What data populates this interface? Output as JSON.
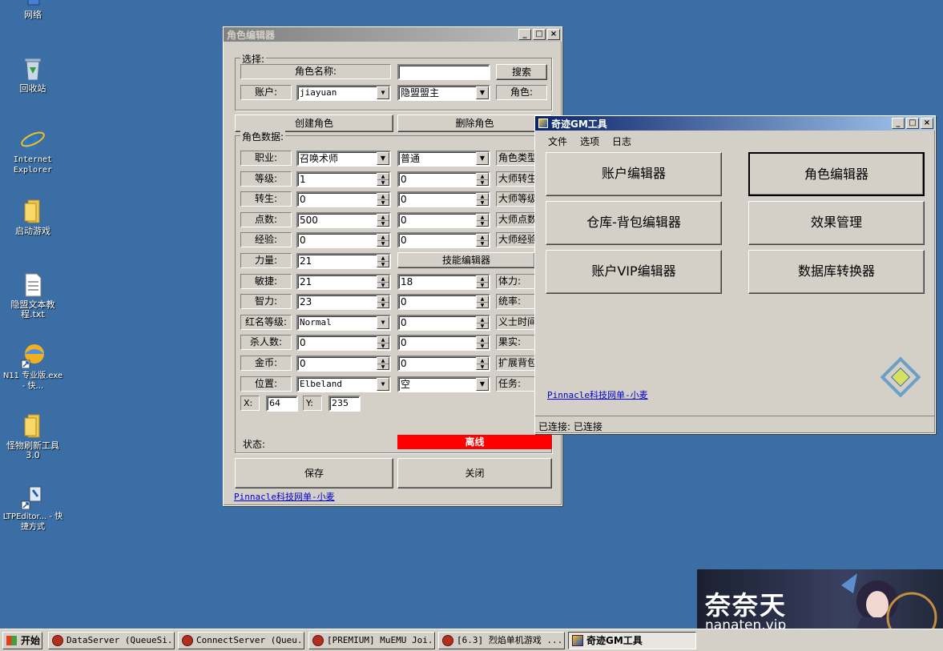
{
  "desktop": {
    "icons": [
      {
        "label": "网络",
        "icon": "network-icon"
      },
      {
        "label": "回收站",
        "icon": "recycle-bin-icon"
      },
      {
        "label": "Internet Explorer",
        "icon": "internet-explorer-icon"
      },
      {
        "label": "启动游戏",
        "icon": "folder-icon"
      },
      {
        "label": "隐盟文本教程.txt",
        "icon": "text-file-icon"
      },
      {
        "label": "N11 专业版.exe - 快...",
        "icon": "shortcut-icon"
      },
      {
        "label": "怪物刷新工具3.0",
        "icon": "folder-icon"
      },
      {
        "label": "LTPEditor... - 快捷方式",
        "icon": "shortcut-icon"
      }
    ]
  },
  "char_editor": {
    "title": "角色编辑器",
    "select_group": "选择:",
    "char_name_label": "角色名称:",
    "char_name_value": "",
    "search_btn": "搜索",
    "account_label": "账户:",
    "account_value": "jiayuan",
    "guild_value": "隐盟盟主",
    "role_label": "角色:",
    "create_btn": "创建角色",
    "delete_btn": "删除角色",
    "data_group": "角色数据:",
    "rows": [
      {
        "label": "职业:",
        "v1": "召唤术师",
        "v2": "普通",
        "r": "角色类型"
      },
      {
        "label": "等级:",
        "v1": "1",
        "v2": "0",
        "r": "大师转生"
      },
      {
        "label": "转生:",
        "v1": "0",
        "v2": "0",
        "r": "大师等级"
      },
      {
        "label": "点数:",
        "v1": "500",
        "v2": "0",
        "r": "大师点数"
      },
      {
        "label": "经验:",
        "v1": "0",
        "v2": "0",
        "r": "大师经验"
      },
      {
        "label": "力量:",
        "v1": "21",
        "v2": "技能编辑器",
        "r": ""
      },
      {
        "label": "敏捷:",
        "v1": "21",
        "v2": "18",
        "r": "体力:"
      },
      {
        "label": "智力:",
        "v1": "23",
        "v2": "0",
        "r": "统率:"
      },
      {
        "label": "红名等级:",
        "v1": "Normal",
        "v2": "0",
        "r": "义士时间"
      },
      {
        "label": "杀人数:",
        "v1": "0",
        "v2": "0",
        "r": "果实:"
      },
      {
        "label": "金币:",
        "v1": "0",
        "v2": "0",
        "r": "扩展背包"
      },
      {
        "label": "位置:",
        "v1": "Elbeland",
        "v2": "空",
        "r": "任务:"
      }
    ],
    "x_label": "X:",
    "x_value": "64",
    "y_label": "Y:",
    "y_value": "235",
    "status_label": "状态:",
    "status_value": "离线",
    "save_btn": "保存",
    "close_btn": "关闭",
    "footer_link": "Pinnacle科技网单-小麦"
  },
  "gm_tool": {
    "title": "奇迹GM工具",
    "menu": [
      "文件",
      "选项",
      "日志"
    ],
    "buttons": [
      "账户编辑器",
      "角色编辑器",
      "仓库-背包编辑器",
      "效果管理",
      "账户VIP编辑器",
      "数据库转换器"
    ],
    "footer_link": "Pinnacle科技网单-小麦",
    "status": "已连接: 已连接"
  },
  "taskbar": {
    "start": "开始",
    "tasks": [
      "DataServer (QueueSi...",
      "ConnectServer (Queu...",
      "[PREMIUM] MuEMU Joi...",
      "[6.3] 烈焰单机游戏 ...",
      "奇迹GM工具"
    ]
  },
  "watermark": {
    "title": "奈奈天",
    "sub": "nanaten.vip"
  },
  "colors": {
    "desktop": "#3a6ea5",
    "status_offline": "#ff0000",
    "title_active": "#0a246a"
  }
}
